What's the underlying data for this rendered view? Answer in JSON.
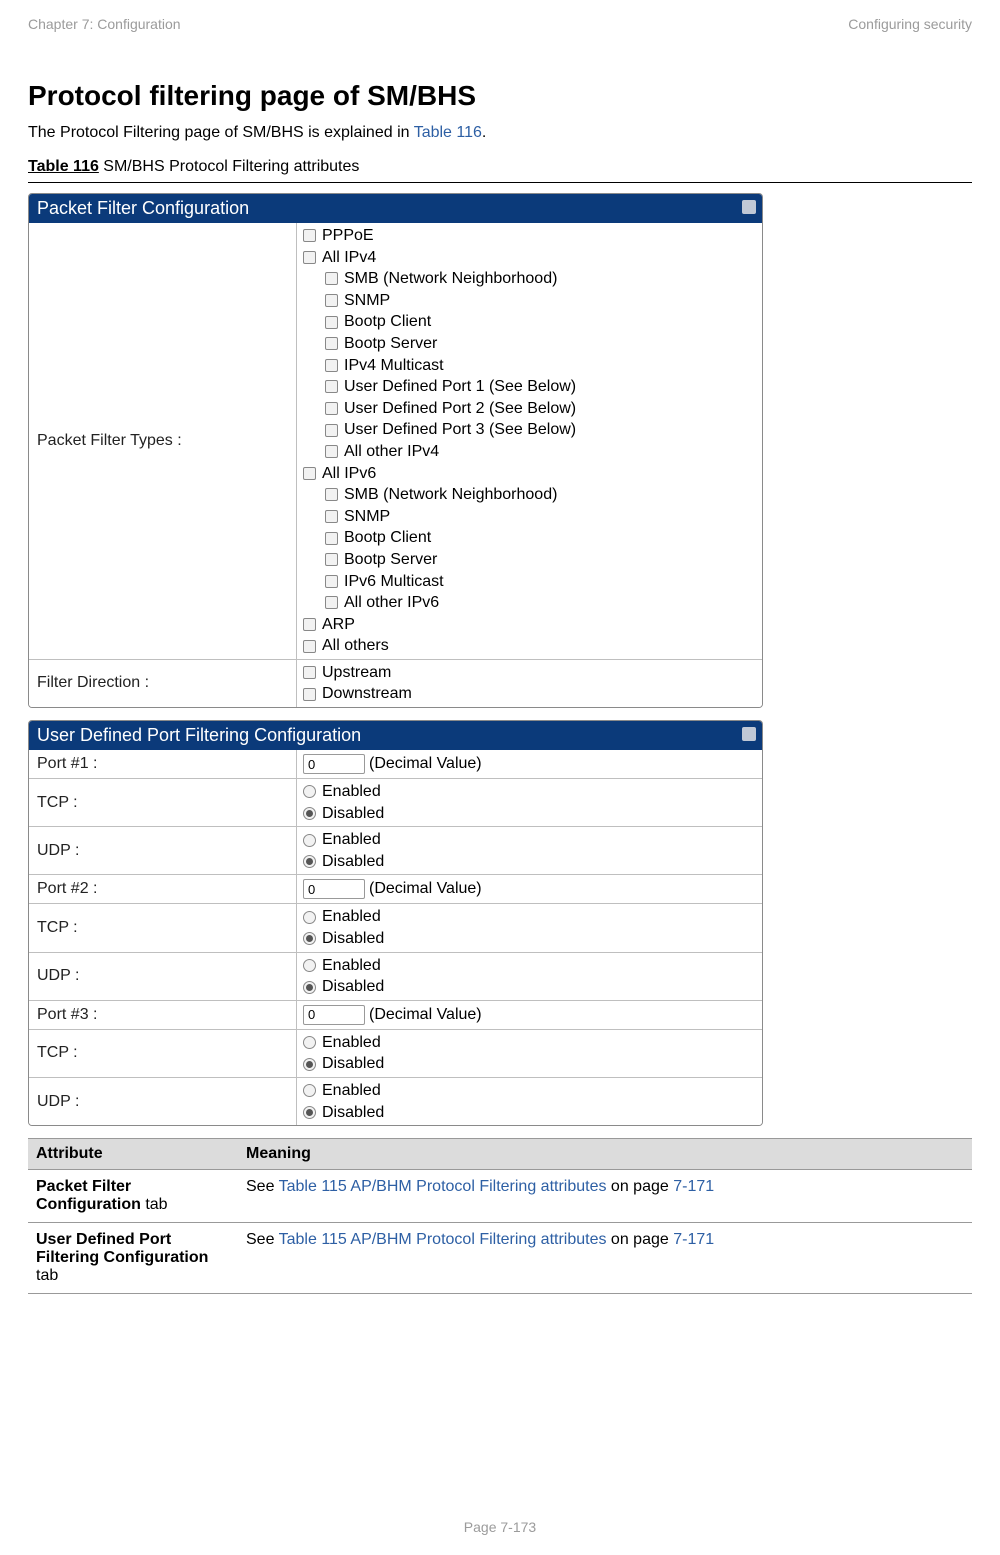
{
  "header": {
    "left": "Chapter 7:  Configuration",
    "right": "Configuring security"
  },
  "title": "Protocol filtering page of SM/BHS",
  "intro_pre": "The Protocol Filtering page of SM/BHS is explained in ",
  "intro_link": "Table 116",
  "intro_post": ".",
  "caption": {
    "label": "Table 116",
    "text": " SM/BHS Protocol Filtering attributes"
  },
  "panels": {
    "pfc": {
      "title": "Packet Filter Configuration",
      "rows": {
        "types": {
          "label": "Packet Filter Types :",
          "items": [
            {
              "indent": 0,
              "label": "PPPoE"
            },
            {
              "indent": 0,
              "label": "All IPv4"
            },
            {
              "indent": 1,
              "label": "SMB (Network Neighborhood)"
            },
            {
              "indent": 1,
              "label": "SNMP"
            },
            {
              "indent": 1,
              "label": "Bootp Client"
            },
            {
              "indent": 1,
              "label": "Bootp Server"
            },
            {
              "indent": 1,
              "label": "IPv4 Multicast"
            },
            {
              "indent": 1,
              "label": "User Defined Port 1 (See Below)"
            },
            {
              "indent": 1,
              "label": "User Defined Port 2 (See Below)"
            },
            {
              "indent": 1,
              "label": "User Defined Port 3 (See Below)"
            },
            {
              "indent": 1,
              "label": "All other IPv4"
            },
            {
              "indent": 0,
              "label": "All IPv6"
            },
            {
              "indent": 1,
              "label": "SMB (Network Neighborhood)"
            },
            {
              "indent": 1,
              "label": "SNMP"
            },
            {
              "indent": 1,
              "label": "Bootp Client"
            },
            {
              "indent": 1,
              "label": "Bootp Server"
            },
            {
              "indent": 1,
              "label": "IPv6 Multicast"
            },
            {
              "indent": 1,
              "label": "All other IPv6"
            },
            {
              "indent": 0,
              "label": "ARP"
            },
            {
              "indent": 0,
              "label": "All others"
            }
          ]
        },
        "direction": {
          "label": "Filter Direction :",
          "items": [
            {
              "label": "Upstream"
            },
            {
              "label": "Downstream"
            }
          ]
        }
      }
    },
    "udpfc": {
      "title": "User Defined Port Filtering Configuration",
      "decimal": "(Decimal Value)",
      "enabled": "Enabled",
      "disabled": "Disabled",
      "ports": [
        {
          "port_label": "Port #1 :",
          "value": "0",
          "tcp_label": "TCP :",
          "udp_label": "UDP :"
        },
        {
          "port_label": "Port #2 :",
          "value": "0",
          "tcp_label": "TCP :",
          "udp_label": "UDP :"
        },
        {
          "port_label": "Port #3 :",
          "value": "0",
          "tcp_label": "TCP :",
          "udp_label": "UDP :"
        }
      ]
    }
  },
  "attrs": {
    "headers": {
      "attr": "Attribute",
      "meaning": "Meaning"
    },
    "rows": [
      {
        "name_bold": "Packet Filter Configuration",
        "name_tab": " tab",
        "see": "See ",
        "link": "Table 115 AP/BHM Protocol Filtering attributes",
        "onpage": " on page ",
        "pageref": "7-171"
      },
      {
        "name_bold": "User Defined Port Filtering Configuration",
        "name_tab": " tab",
        "see": "See ",
        "link": "Table 115 AP/BHM Protocol Filtering attributes",
        "onpage": " on page ",
        "pageref": "7-171"
      }
    ]
  },
  "footer": "Page 7-173"
}
